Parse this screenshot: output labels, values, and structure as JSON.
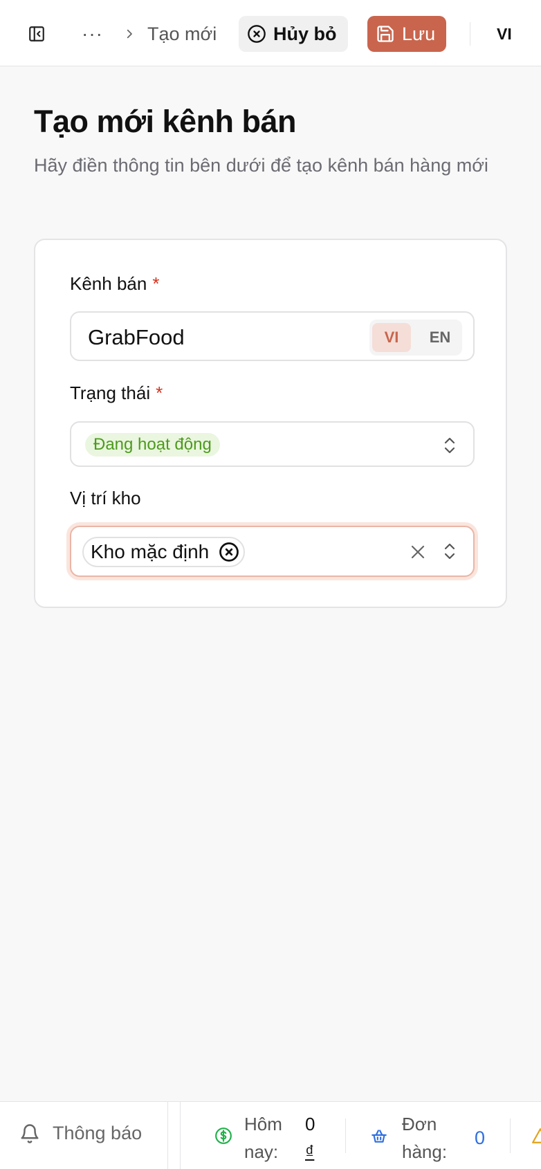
{
  "topbar": {
    "breadcrumb_ellipsis": "···",
    "breadcrumb_current": "Tạo mới",
    "cancel_label": "Hủy bỏ",
    "save_label": "Lưu",
    "language": "VI",
    "accent_color": "#c9654d"
  },
  "page": {
    "title": "Tạo mới kênh bán",
    "subtitle": "Hãy điền thông tin bên dưới để tạo kênh bán hàng mới"
  },
  "form": {
    "channel": {
      "label": "Kênh bán",
      "required_mark": "*",
      "value": "GrabFood",
      "lang_options": [
        "VI",
        "EN"
      ],
      "lang_selected": "VI"
    },
    "status": {
      "label": "Trạng thái",
      "required_mark": "*",
      "value": "Đang hoạt động",
      "badge_color": "#4d9a1e"
    },
    "warehouse": {
      "label": "Vị trí kho",
      "selected_tags": [
        "Kho mặc định"
      ]
    }
  },
  "footer": {
    "notifications_label": "Thông báo",
    "today_label_1": "Hôm",
    "today_label_2": "nay:",
    "today_value": "0",
    "today_currency": "₫",
    "orders_label_1": "Đơn",
    "orders_label_2": "hàng:",
    "orders_value": "0"
  },
  "icons": [
    "sidebar-toggle-icon",
    "chevron-right-icon",
    "x-circle-icon",
    "floppy-disk-icon",
    "chevron-up-down-icon",
    "x-icon",
    "bell-icon",
    "dollar-circle-icon",
    "basket-icon",
    "warning-icon"
  ]
}
